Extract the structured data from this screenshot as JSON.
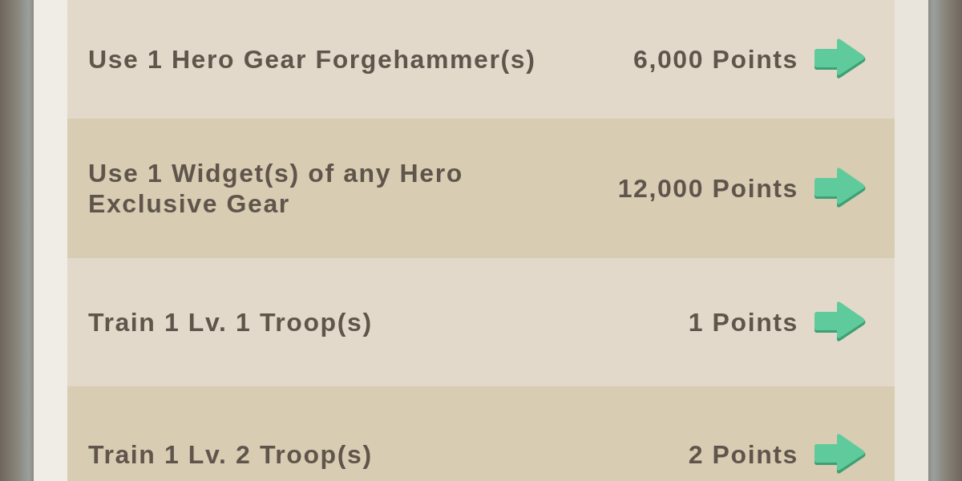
{
  "tasks": [
    {
      "description": "Use 1 Hero Gear Forgehammer(s)",
      "points": "6,000 Points"
    },
    {
      "description": "Use 1 Widget(s) of any Hero Exclusive Gear",
      "points": "12,000 Points"
    },
    {
      "description": "Train 1 Lv. 1 Troop(s)",
      "points": "1 Points"
    },
    {
      "description": "Train 1 Lv. 2 Troop(s)",
      "points": "2 Points"
    }
  ]
}
